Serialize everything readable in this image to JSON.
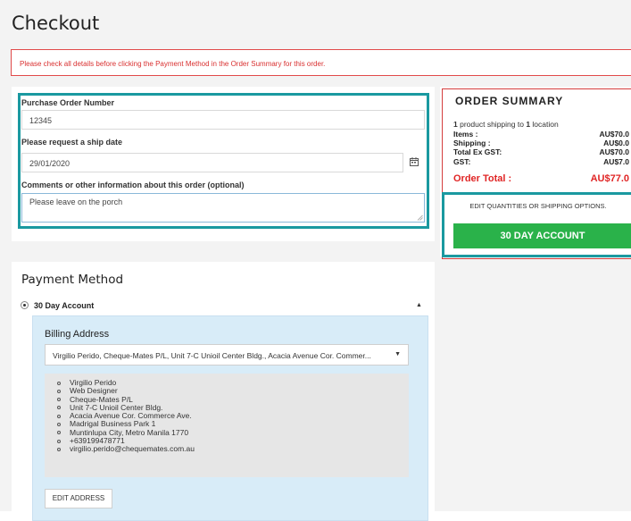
{
  "page": {
    "title": "Checkout"
  },
  "notice": "Please check all details before clicking the Payment Method in the Order Summary for this order.",
  "order_details": {
    "po_label": "Purchase Order Number",
    "po_value": "12345",
    "ship_date_label": "Please request a ship date",
    "ship_date_value": "29/01/2020",
    "comments_label": "Comments or other information about this order (optional)",
    "comments_value": "Please leave on the porch"
  },
  "summary": {
    "title": "ORDER SUMMARY",
    "product_count": "1",
    "shipping_text_1": "product shipping to",
    "location_count": "1",
    "shipping_text_2": "location",
    "rows": [
      {
        "label": "Items :",
        "value": "AU$70.0"
      },
      {
        "label": "Shipping :",
        "value": "AU$0.0"
      },
      {
        "label": "Total Ex GST:",
        "value": "AU$70.0"
      },
      {
        "label": "GST:",
        "value": "AU$7.0"
      }
    ],
    "total_label": "Order Total :",
    "total_value": "AU$77.0",
    "edit_options": "EDIT QUANTITIES OR SHIPPING OPTIONS.",
    "account_button": "30 DAY ACCOUNT"
  },
  "payment": {
    "title": "Payment Method",
    "option_label": "30 Day Account",
    "billing_title": "Billing Address",
    "selected_address": "Virgilio Perido, Cheque-Mates P/L, Unit 7-C Unioil Center Bldg., Acacia Avenue Cor. Commer...",
    "address_lines": [
      "Virgilio Perido",
      "Web Designer",
      "Cheque-Mates P/L",
      "Unit 7-C Unioil Center Bldg.",
      "Acacia Avenue Cor. Commerce Ave.",
      "Madrigal Business Park 1",
      "Muntinlupa City, Metro Manila 1770",
      "+639199478771",
      "virgilio.perido@chequemates.com.au"
    ],
    "edit_address_button": "EDIT ADDRESS"
  },
  "colors": {
    "highlight": "#1a99a0",
    "notice_red": "#d93030",
    "total_red": "#e02525",
    "account_green": "#2ab24a",
    "billing_blue": "#d8ecf8"
  },
  "icons": [
    "calendar-icon",
    "collapse-caret-icon",
    "dropdown-caret-icon"
  ]
}
